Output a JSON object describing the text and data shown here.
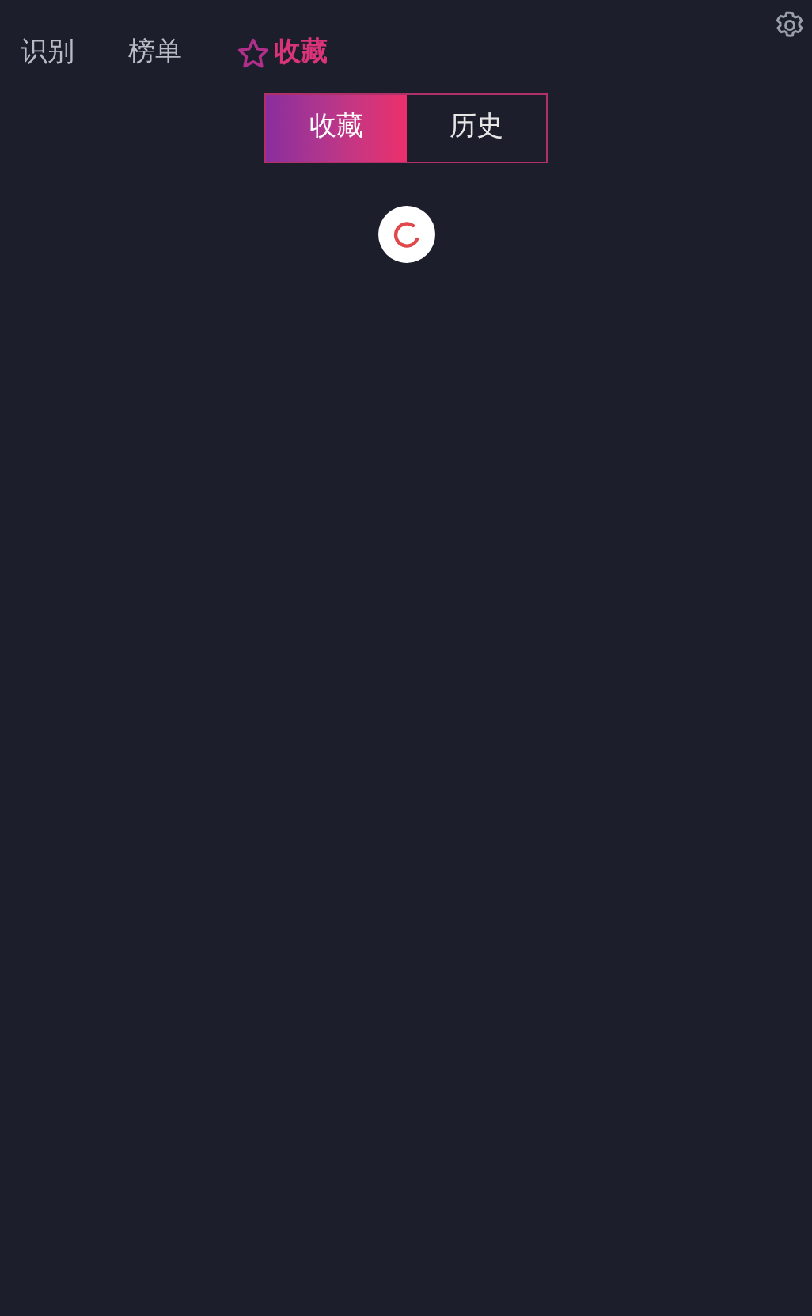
{
  "nav_tabs": [
    {
      "label": "识别",
      "selected": false
    },
    {
      "label": "榜单",
      "selected": false
    },
    {
      "label": "收藏",
      "selected": true
    }
  ],
  "segments": [
    {
      "label": "收藏",
      "selected": true
    },
    {
      "label": "历史",
      "selected": false
    }
  ],
  "loading": true
}
